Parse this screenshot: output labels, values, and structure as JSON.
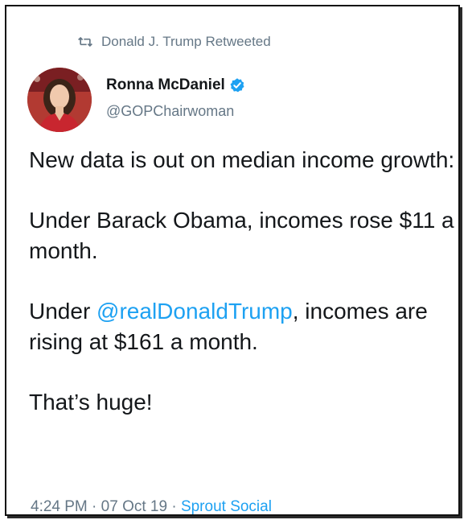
{
  "retweet_banner": {
    "icon": "retweet-icon",
    "text": "Donald J. Trump Retweeted"
  },
  "author": {
    "display_name": "Ronna McDaniel",
    "verified_icon": "verified-badge-icon",
    "handle": "@GOPChairwoman"
  },
  "tweet": {
    "paragraph_1": "New data is out on median income growth:",
    "paragraph_2": "Under Barack Obama, incomes rose $11 a month.",
    "paragraph_3_before": "Under ",
    "paragraph_3_mention": "@realDonaldTrump",
    "paragraph_3_after": ", incomes are rising at $161 a month.",
    "paragraph_4": "That’s huge!"
  },
  "meta": {
    "time": "4:24 PM",
    "separator_1": " · ",
    "date": "07 Oct 19",
    "separator_2": " · ",
    "source": "Sprout Social"
  },
  "colors": {
    "link_blue": "#1da1f2",
    "secondary_gray": "#657786",
    "text_dark": "#14171a"
  }
}
